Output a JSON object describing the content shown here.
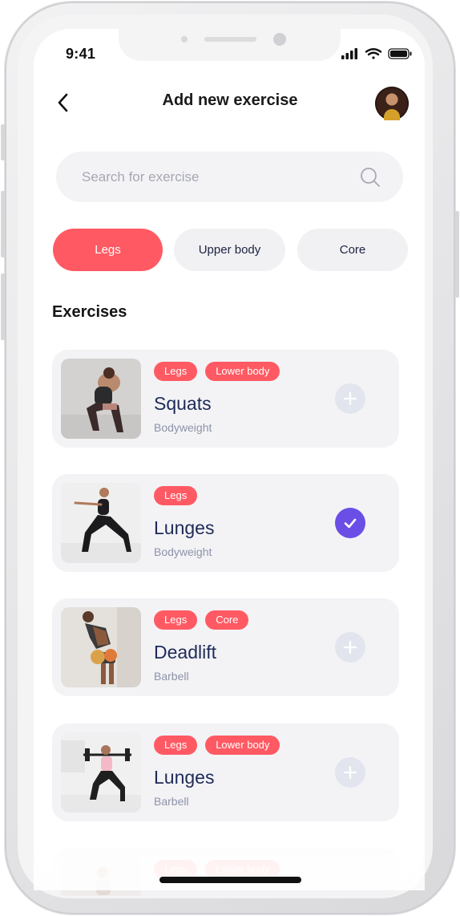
{
  "status_bar": {
    "time": "9:41"
  },
  "header": {
    "title": "Add new exercise"
  },
  "search": {
    "placeholder": "Search for exercise"
  },
  "filters": [
    {
      "label": "Legs",
      "active": true
    },
    {
      "label": "Upper body",
      "active": false
    },
    {
      "label": "Core",
      "active": false
    }
  ],
  "section": {
    "title": "Exercises"
  },
  "exercises": [
    {
      "tags": [
        "Legs",
        "Lower body"
      ],
      "name": "Squats",
      "equipment": "Bodyweight",
      "selected": false,
      "action_icon": "plus-icon"
    },
    {
      "tags": [
        "Legs"
      ],
      "name": "Lunges",
      "equipment": "Bodyweight",
      "selected": true,
      "action_icon": "checkmark-icon"
    },
    {
      "tags": [
        "Legs",
        "Core"
      ],
      "name": "Deadlift",
      "equipment": "Barbell",
      "selected": false,
      "action_icon": "plus-icon"
    },
    {
      "tags": [
        "Legs",
        "Lower body"
      ],
      "name": "Lunges",
      "equipment": "Barbell",
      "selected": false,
      "action_icon": "plus-icon"
    },
    {
      "tags": [
        "Legs",
        "Lower body"
      ],
      "name": "",
      "equipment": "",
      "selected": false,
      "action_icon": "plus-icon"
    }
  ],
  "colors": {
    "accent": "#ff5a63",
    "selected": "#6a4ee6",
    "card_bg": "#f3f3f6",
    "title_text": "#1f2b57"
  }
}
